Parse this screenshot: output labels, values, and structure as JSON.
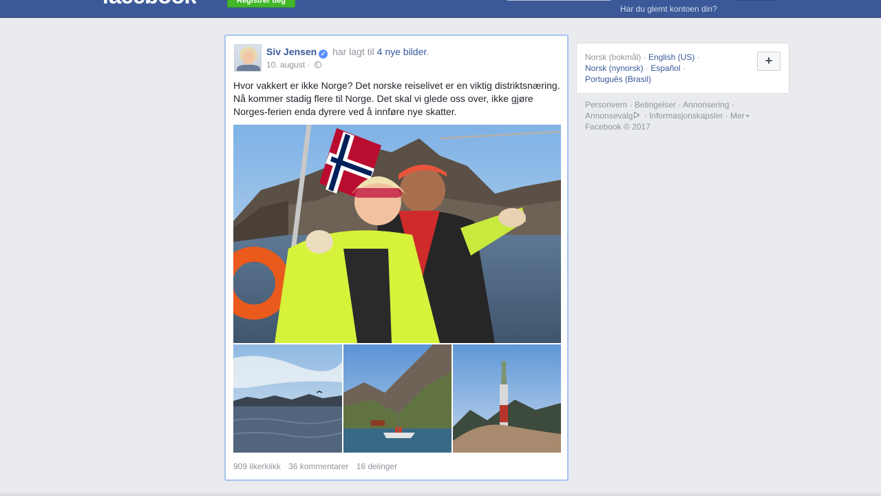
{
  "topbar": {
    "logo_text": "facebook",
    "register_button": "Registrer deg",
    "forgot_account": "Har du glemt kontoen din?"
  },
  "post": {
    "author": "Siv Jensen",
    "action_text": "har lagt til",
    "action_link": "4 nye bilder",
    "action_end": ".",
    "date": "10. august",
    "date_separator": "·",
    "audience_icon": "globe-icon",
    "verified_icon": "verified-badge-icon",
    "text": "Hvor vakkert er ikke Norge? Det norske reiselivet er en viktig distriktsnæring. Nå kommer stadig flere til Norge. Det skal vi glede oss over, ikke gjøre Norges-ferien enda dyrere ved å innføre nye skatter.",
    "stats": {
      "likes": "909 likerklikk",
      "comments": "36 kommentarer",
      "shares": "16 delinger"
    }
  },
  "languages": {
    "current": "Norsk (bokmål)",
    "items": [
      "English (US)",
      "Norsk (nynorsk)",
      "Español",
      "Português (Brasil)"
    ],
    "more_button": "+"
  },
  "footer": {
    "links": [
      "Personvern",
      "Betingelser",
      "Annonsering",
      "Annonsevalg",
      "Informasjonskapsler",
      "Mer"
    ],
    "copyright": "Facebook © 2017"
  },
  "colors": {
    "brand_blue": "#3b5998",
    "link_blue": "#365899",
    "register_green": "#42b72a",
    "page_bg": "#e9ebee"
  }
}
